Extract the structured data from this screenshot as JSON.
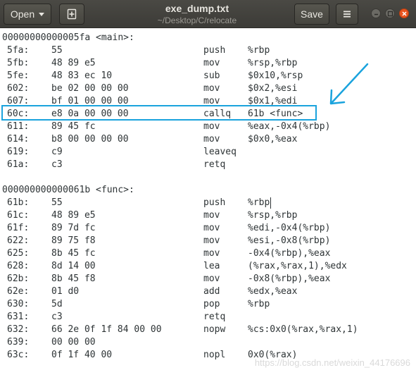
{
  "header": {
    "open_label": "Open",
    "title": "exe_dump.txt",
    "path": "~/Desktop/C/relocate",
    "save_label": "Save",
    "icons": {
      "open_caret": "chevron-down-icon",
      "new_tab": "new-document-icon",
      "menu": "hamburger-menu-icon",
      "minimize": "minimize-icon",
      "maximize": "maximize-icon",
      "close": "close-icon"
    }
  },
  "colors": {
    "highlight_box": "#1aa3dd",
    "arrow": "#1aa3dd",
    "close_button": "#e9541f",
    "header_bg": "#3c3b37"
  },
  "sections": [
    {
      "label": "00000000000005fa <main>:",
      "lines": [
        {
          "addr": "5fa:",
          "hex": "55",
          "mnemonic": "push",
          "operands": "%rbp"
        },
        {
          "addr": "5fb:",
          "hex": "48 89 e5",
          "mnemonic": "mov",
          "operands": "%rsp,%rbp"
        },
        {
          "addr": "5fe:",
          "hex": "48 83 ec 10",
          "mnemonic": "sub",
          "operands": "$0x10,%rsp"
        },
        {
          "addr": "602:",
          "hex": "be 02 00 00 00",
          "mnemonic": "mov",
          "operands": "$0x2,%esi"
        },
        {
          "addr": "607:",
          "hex": "bf 01 00 00 00",
          "mnemonic": "mov",
          "operands": "$0x1,%edi"
        },
        {
          "addr": "60c:",
          "hex": "e8 0a 00 00 00",
          "mnemonic": "callq",
          "operands": "61b <func>"
        },
        {
          "addr": "611:",
          "hex": "89 45 fc",
          "mnemonic": "mov",
          "operands": "%eax,-0x4(%rbp)"
        },
        {
          "addr": "614:",
          "hex": "b8 00 00 00 00",
          "mnemonic": "mov",
          "operands": "$0x0,%eax"
        },
        {
          "addr": "619:",
          "hex": "c9",
          "mnemonic": "leaveq",
          "operands": ""
        },
        {
          "addr": "61a:",
          "hex": "c3",
          "mnemonic": "retq",
          "operands": ""
        }
      ]
    },
    {
      "label": "000000000000061b <func>:",
      "lines": [
        {
          "addr": "61b:",
          "hex": "55",
          "mnemonic": "push",
          "operands": "%rbp"
        },
        {
          "addr": "61c:",
          "hex": "48 89 e5",
          "mnemonic": "mov",
          "operands": "%rsp,%rbp"
        },
        {
          "addr": "61f:",
          "hex": "89 7d fc",
          "mnemonic": "mov",
          "operands": "%edi,-0x4(%rbp)"
        },
        {
          "addr": "622:",
          "hex": "89 75 f8",
          "mnemonic": "mov",
          "operands": "%esi,-0x8(%rbp)"
        },
        {
          "addr": "625:",
          "hex": "8b 45 fc",
          "mnemonic": "mov",
          "operands": "-0x4(%rbp),%eax"
        },
        {
          "addr": "628:",
          "hex": "8d 14 00",
          "mnemonic": "lea",
          "operands": "(%rax,%rax,1),%edx"
        },
        {
          "addr": "62b:",
          "hex": "8b 45 f8",
          "mnemonic": "mov",
          "operands": "-0x8(%rbp),%eax"
        },
        {
          "addr": "62e:",
          "hex": "01 d0",
          "mnemonic": "add",
          "operands": "%edx,%eax"
        },
        {
          "addr": "630:",
          "hex": "5d",
          "mnemonic": "pop",
          "operands": "%rbp"
        },
        {
          "addr": "631:",
          "hex": "c3",
          "mnemonic": "retq",
          "operands": ""
        },
        {
          "addr": "632:",
          "hex": "66 2e 0f 1f 84 00 00",
          "mnemonic": "nopw",
          "operands": "%cs:0x0(%rax,%rax,1)"
        },
        {
          "addr": "639:",
          "hex": "00 00 00",
          "mnemonic": "",
          "operands": ""
        },
        {
          "addr": "63c:",
          "hex": "0f 1f 40 00",
          "mnemonic": "nopl",
          "operands": "0x0(%rax)"
        }
      ]
    }
  ],
  "highlighted_line": "60c:",
  "watermark": "https://blog.csdn.net/weixin_44176696"
}
